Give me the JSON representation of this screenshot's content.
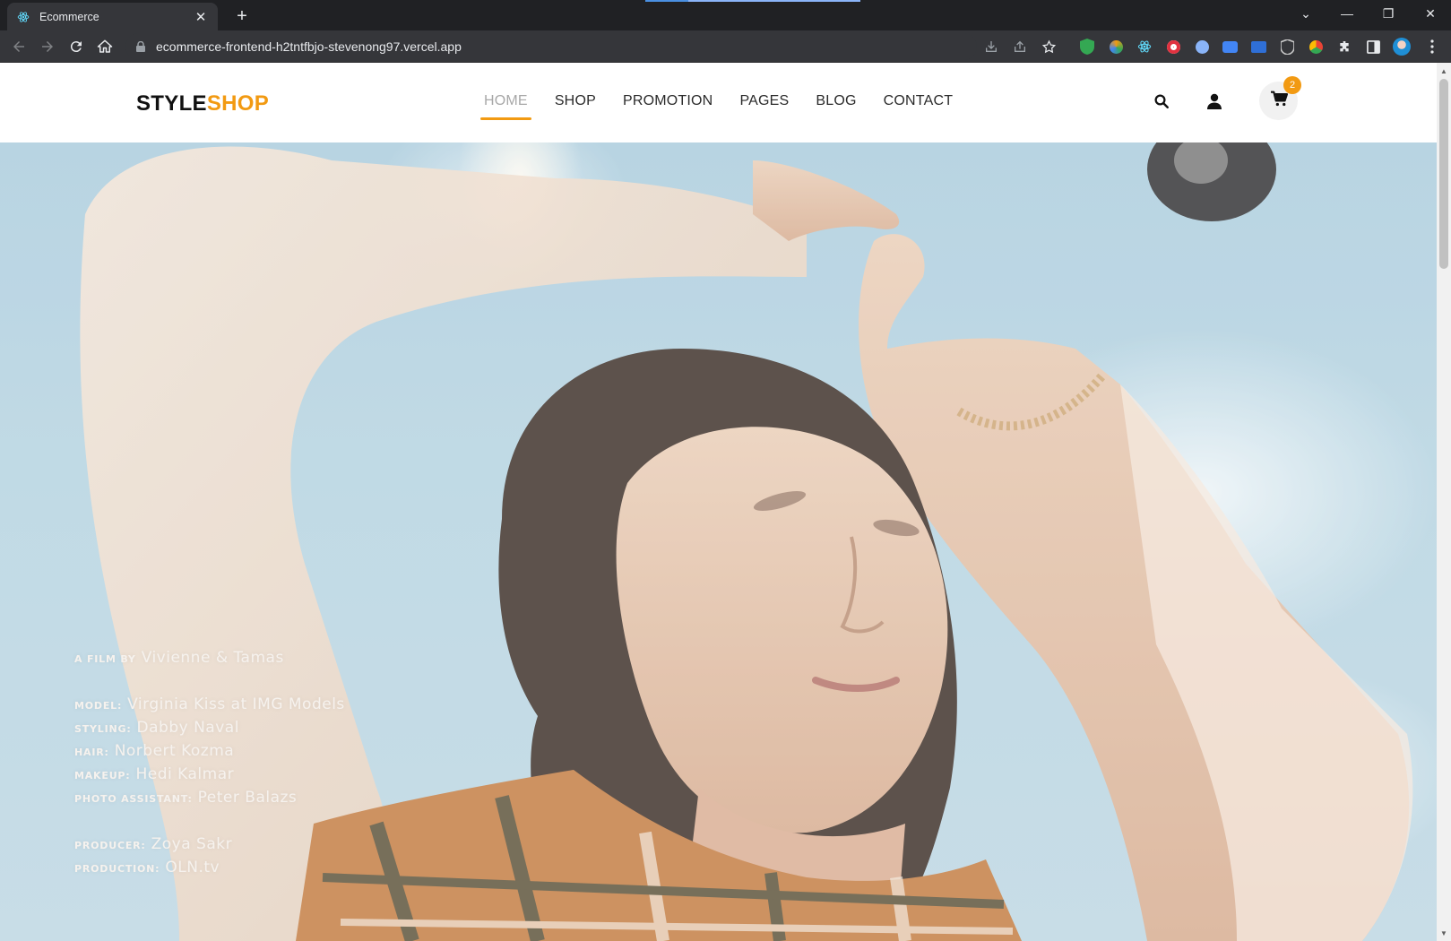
{
  "browser": {
    "tab_title": "Ecommerce",
    "tab_close": "✕",
    "new_tab": "+",
    "url": "ecommerce-frontend-h2tntfbjo-stevenong97.vercel.app",
    "window_controls": {
      "tabsearch": "⌄",
      "minimize": "—",
      "restore": "❐",
      "close": "✕"
    },
    "extensions": [
      "download-icon",
      "share-icon",
      "star-icon",
      "shield-green-icon",
      "colorful-ext-icon",
      "react-devtools-icon",
      "opera-icon",
      "vpn-icon",
      "camera-ext-icon",
      "gallery-ext-icon",
      "brave-shield-icon",
      "chrome-color-icon",
      "puzzle-icon",
      "sidepanel-icon",
      "profile-avatar",
      "menu-icon"
    ]
  },
  "header": {
    "logo_part1": "STYLE",
    "logo_part2": "SHOP",
    "nav": [
      {
        "label": "HOME",
        "active": true
      },
      {
        "label": "SHOP",
        "active": false
      },
      {
        "label": "PROMOTION",
        "active": false
      },
      {
        "label": "PAGES",
        "active": false
      },
      {
        "label": "BLOG",
        "active": false
      },
      {
        "label": "CONTACT",
        "active": false
      }
    ],
    "cart_count": "2"
  },
  "hero": {
    "credits": [
      {
        "label": "A film by",
        "value": "Vivienne & Tamas"
      },
      {
        "label": "Model:",
        "value": "Virginia Kiss at IMG Models"
      },
      {
        "label": "Styling:",
        "value": "Dabby Naval"
      },
      {
        "label": "Hair:",
        "value": "Norbert Kozma"
      },
      {
        "label": "Makeup:",
        "value": "Hedi Kalmar"
      },
      {
        "label": "Photo assistant:",
        "value": "Peter Balazs"
      },
      {
        "label": "Producer:",
        "value": "Zoya Sakr"
      },
      {
        "label": "Production:",
        "value": "OLN.tv"
      }
    ]
  },
  "colors": {
    "accent": "#f29a12",
    "sky": "#b3d2e0",
    "chrome_dark": "#202124",
    "chrome_mid": "#35363a"
  }
}
